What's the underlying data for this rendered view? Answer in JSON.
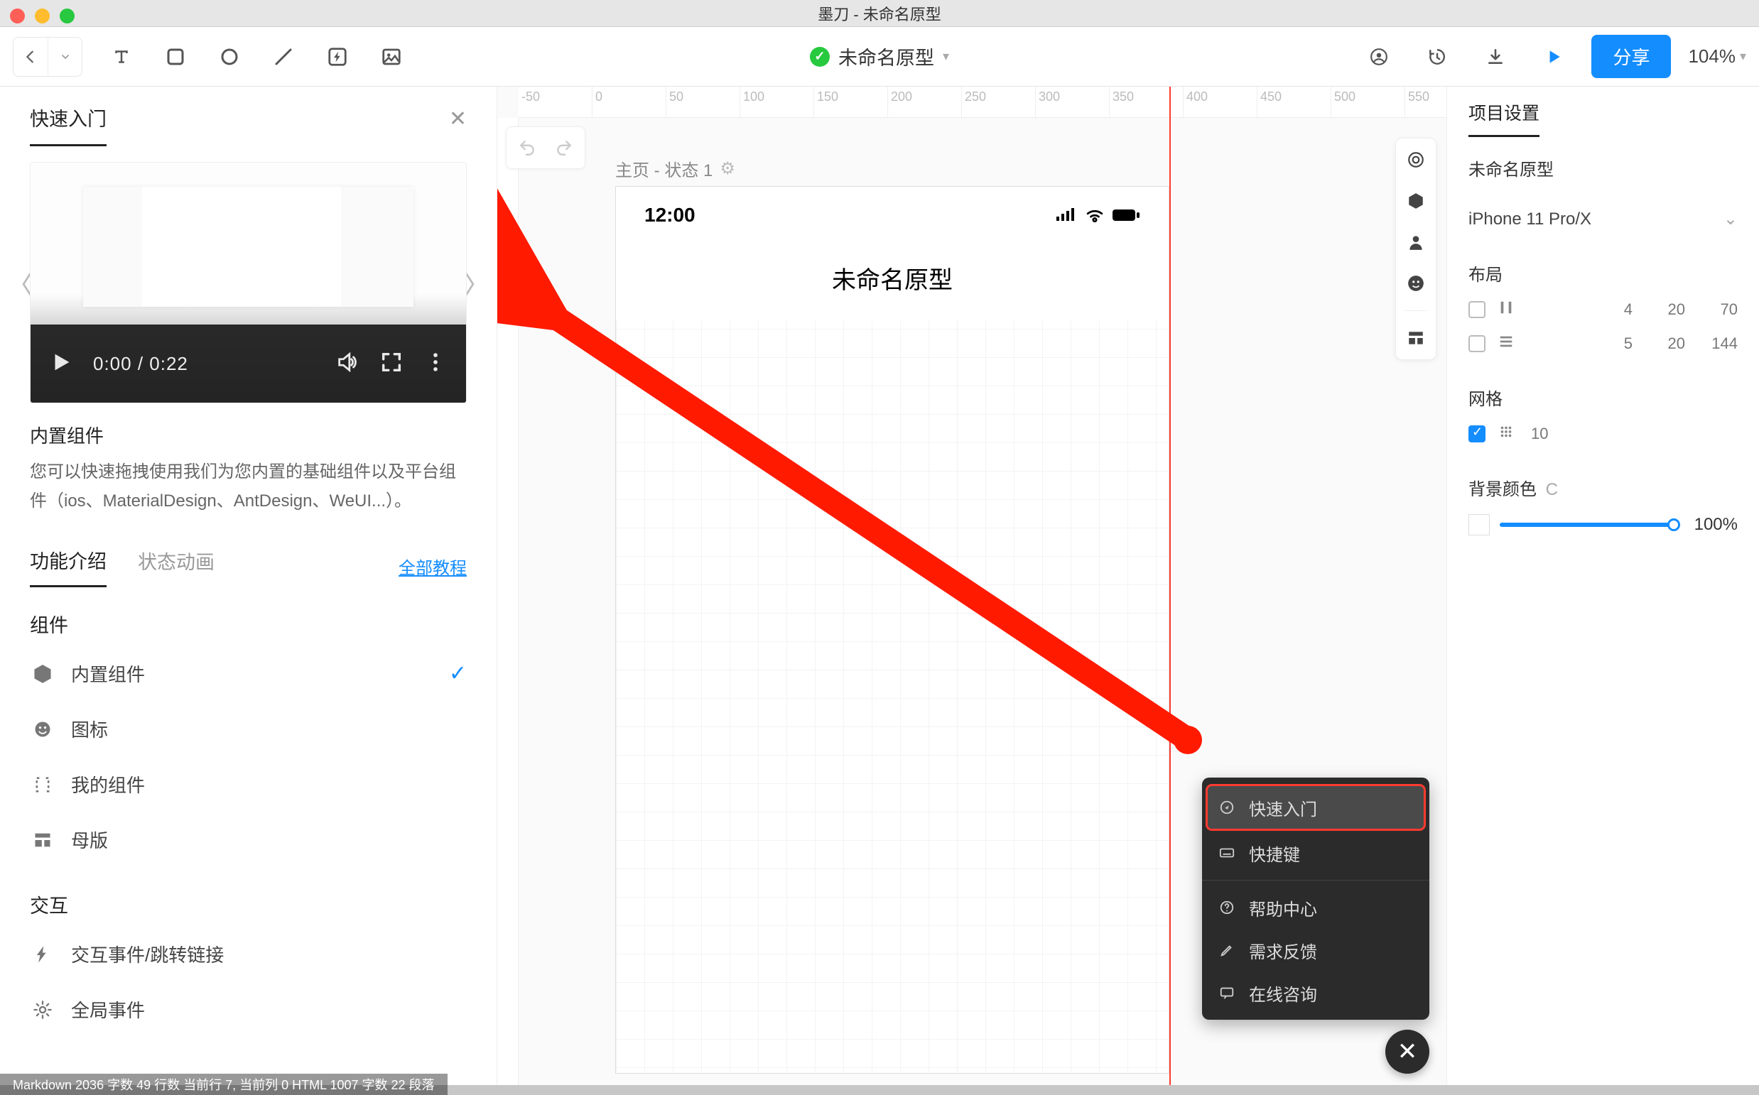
{
  "window": {
    "title": "墨刀 - 未命名原型"
  },
  "toolbar": {
    "project_name": "未命名原型",
    "share_label": "分享",
    "zoom": "104%"
  },
  "left_panel": {
    "header": "快速入门",
    "video": {
      "time": "0:00 / 0:22"
    },
    "feature_title": "内置组件",
    "feature_desc": "您可以快速拖拽使用我们为您内置的基础组件以及平台组件（ios、MaterialDesign、AntDesign、WeUI...）。",
    "tabs": {
      "t1": "功能介绍",
      "t2": "状态动画",
      "all": "全部教程"
    },
    "sections": {
      "components": "组件",
      "interaction": "交互"
    },
    "items": {
      "builtin": "内置组件",
      "icons": "图标",
      "mine": "我的组件",
      "master": "母版",
      "link": "交互事件/跳转链接",
      "global": "全局事件"
    }
  },
  "canvas": {
    "page_label": "主页 - 状态 1",
    "device_time": "12:00",
    "device_title": "未命名原型",
    "ruler_ticks": [
      "-50",
      "0",
      "50",
      "100",
      "150",
      "200",
      "250",
      "300",
      "350",
      "400",
      "450",
      "500",
      "550"
    ]
  },
  "help_menu": {
    "quick_start": "快速入门",
    "shortcuts": "快捷键",
    "help_center": "帮助中心",
    "feedback": "需求反馈",
    "chat": "在线咨询"
  },
  "right_panel": {
    "tab": "项目设置",
    "project_name": "未命名原型",
    "device": "iPhone 11 Pro/X",
    "layout_h": "布局",
    "layout_row1": {
      "a": "4",
      "b": "20",
      "c": "70"
    },
    "layout_row2": {
      "a": "5",
      "b": "20",
      "c": "144"
    },
    "grid_h": "网格",
    "grid_val": "10",
    "bg_h": "背景颜色",
    "bg_suffix": "C",
    "bg_opacity": "100%"
  },
  "statusbar_fragment": "Markdown  2036 字数  49 行数  当前行 7, 当前列 0      HTML  1007 字数  22 段落"
}
